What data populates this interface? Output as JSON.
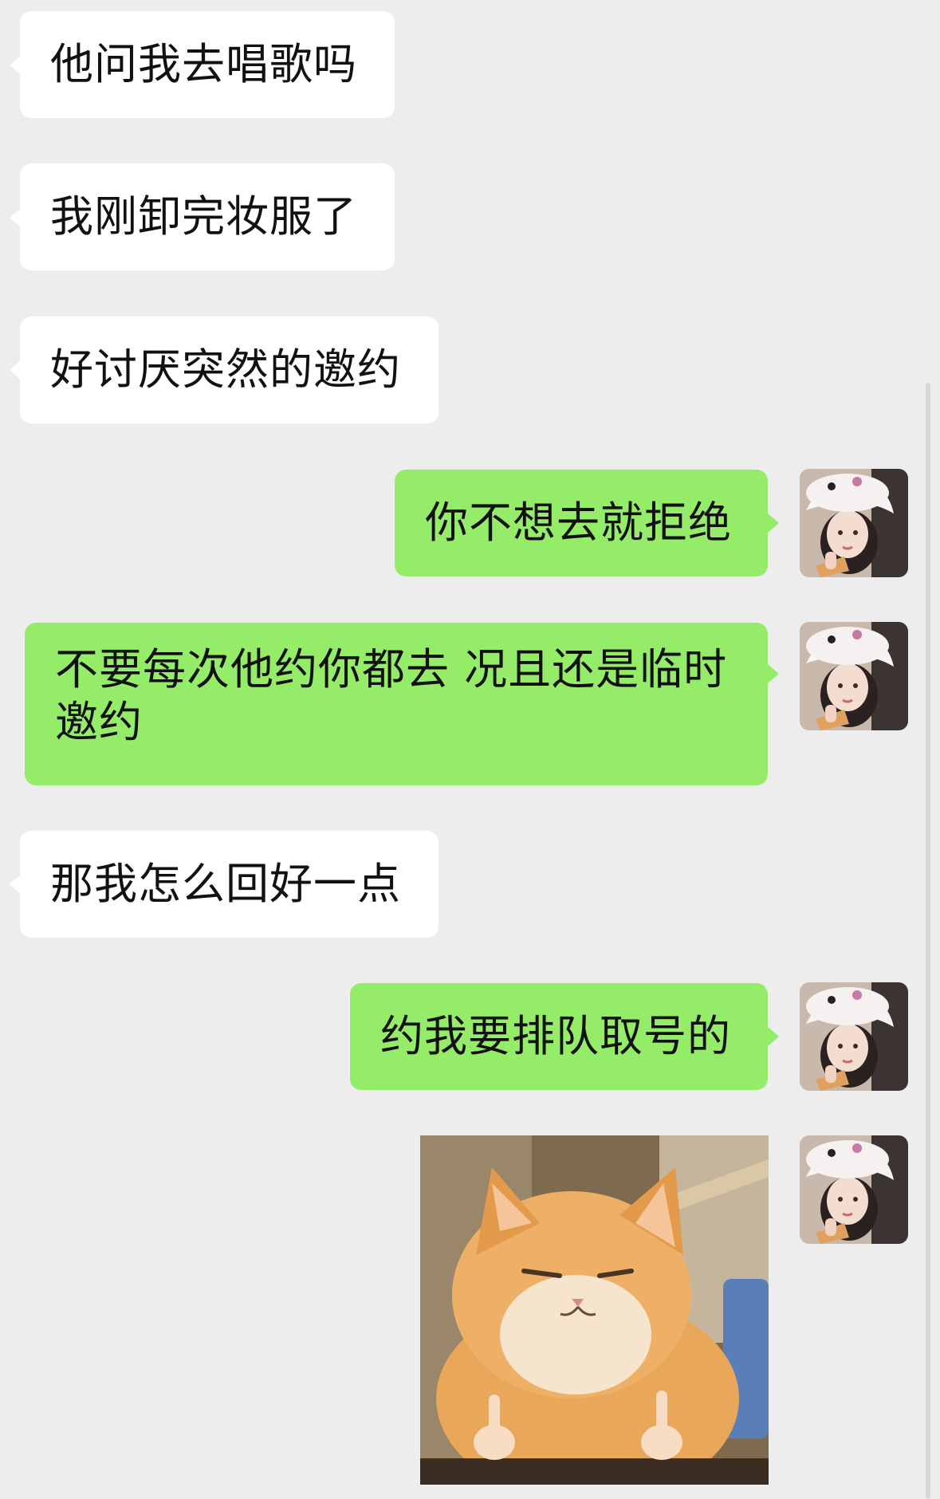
{
  "messages": [
    {
      "side": "in",
      "text": "他问我去唱歌吗"
    },
    {
      "side": "in",
      "text": "我刚卸完妆服了"
    },
    {
      "side": "in",
      "text": "好讨厌突然的邀约"
    },
    {
      "side": "out",
      "text": "你不想去就拒绝"
    },
    {
      "side": "out",
      "text": "不要每次他约你都去 况且还是临时邀约"
    },
    {
      "side": "in",
      "text": "那我怎么回好一点"
    },
    {
      "side": "out",
      "text": "约我要排队取号的"
    },
    {
      "side": "out",
      "type": "image",
      "image": "cat-middle-finger-sticker"
    }
  ],
  "colors": {
    "background": "#ededed",
    "incoming_bubble": "#ffffff",
    "outgoing_bubble": "#95ec69"
  },
  "icons": {
    "avatar": "avatar-girl-white-bunny-hat",
    "sticker": "orange-cat-middle-finger"
  }
}
